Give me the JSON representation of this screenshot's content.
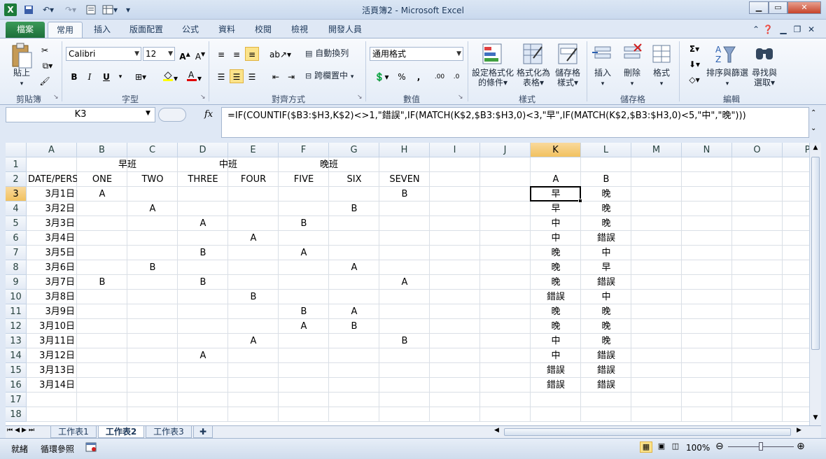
{
  "window": {
    "title": "活頁簿2  -  Microsoft Excel",
    "app_icon": "X"
  },
  "quick_access": [
    "save-icon",
    "undo-icon",
    "redo-icon",
    "print-preview-icon",
    "table-icon",
    "customize-icon"
  ],
  "tabs": [
    "檔案",
    "常用",
    "插入",
    "版面配置",
    "公式",
    "資料",
    "校閱",
    "檢視",
    "開發人員"
  ],
  "ribbon": {
    "clipboard": {
      "paste": "貼上",
      "label": "剪貼簿"
    },
    "font": {
      "name": "Calibri",
      "size": "12",
      "bold": "B",
      "italic": "I",
      "underline": "U",
      "label": "字型"
    },
    "alignment": {
      "wrap": "自動換列",
      "merge": "跨欄置中",
      "label": "對齊方式"
    },
    "number": {
      "format": "通用格式",
      "percent": "%",
      "comma": ",",
      "label": "數值"
    },
    "styles": {
      "conditional": [
        "設定格式化",
        "的條件"
      ],
      "format_table": [
        "格式化為",
        "表格"
      ],
      "cell_styles": [
        "儲存格",
        "樣式"
      ],
      "label": "樣式"
    },
    "cells": {
      "insert": "插入",
      "delete": "刪除",
      "format": "格式",
      "label": "儲存格"
    },
    "editing": {
      "sort": "排序與篩選",
      "find": [
        "尋找與",
        "選取"
      ],
      "label": "編輯"
    }
  },
  "formula_bar": {
    "name_box": "K3",
    "fx": "fx",
    "formula": "=IF(COUNTIF($B3:$H3,K$2)<>1,\"錯誤\",IF(MATCH(K$2,$B3:$H3,0)<3,\"早\",IF(MATCH(K$2,$B3:$H3,0)<5,\"中\",\"晚\")))"
  },
  "grid": {
    "columns": [
      "A",
      "B",
      "C",
      "D",
      "E",
      "F",
      "G",
      "H",
      "I",
      "J",
      "K",
      "L",
      "M",
      "N",
      "O",
      "P"
    ],
    "rows": [
      "1",
      "2",
      "3",
      "4",
      "5",
      "6",
      "7",
      "8",
      "9",
      "10",
      "11",
      "12",
      "13",
      "14",
      "15",
      "16",
      "17",
      "18"
    ],
    "active_cell": "K3",
    "row1": {
      "B": "早班",
      "D": "中班",
      "F": "晚班"
    },
    "row2": {
      "A": "DATE/PERS",
      "B": "ONE",
      "C": "TWO",
      "D": "THREE",
      "E": "FOUR",
      "F": "FIVE",
      "G": "SIX",
      "H": "SEVEN",
      "K": "A",
      "L": "B"
    },
    "data": [
      {
        "A": "3月1日",
        "B": "A",
        "H": "B",
        "K": "早",
        "L": "晚"
      },
      {
        "A": "3月2日",
        "C": "A",
        "G": "B",
        "K": "早",
        "L": "晚"
      },
      {
        "A": "3月3日",
        "D": "A",
        "F": "B",
        "K": "中",
        "L": "晚"
      },
      {
        "A": "3月4日",
        "E": "A",
        "K": "中",
        "L": "錯誤"
      },
      {
        "A": "3月5日",
        "D": "B",
        "F": "A",
        "K": "晚",
        "L": "中"
      },
      {
        "A": "3月6日",
        "C": "B",
        "G": "A",
        "K": "晚",
        "L": "早"
      },
      {
        "A": "3月7日",
        "B": "B",
        "D": "B",
        "H": "A",
        "K": "晚",
        "L": "錯誤"
      },
      {
        "A": "3月8日",
        "E": "B",
        "K": "錯誤",
        "L": "中"
      },
      {
        "A": "3月9日",
        "F": "B",
        "G": "A",
        "K": "晚",
        "L": "晚"
      },
      {
        "A": "3月10日",
        "F": "A",
        "G": "B",
        "K": "晚",
        "L": "晚"
      },
      {
        "A": "3月11日",
        "E": "A",
        "H": "B",
        "K": "中",
        "L": "晚"
      },
      {
        "A": "3月12日",
        "D": "A",
        "K": "中",
        "L": "錯誤"
      },
      {
        "A": "3月13日",
        "K": "錯誤",
        "L": "錯誤"
      },
      {
        "A": "3月14日",
        "K": "錯誤",
        "L": "錯誤"
      }
    ]
  },
  "sheets": [
    "工作表1",
    "工作表2",
    "工作表3"
  ],
  "active_sheet": "工作表2",
  "status": {
    "ready": "就緒",
    "circular": "循環參照",
    "zoom": "100%"
  },
  "colors": {
    "file_tab": "#1e6f3a",
    "selection": "#f1c15f",
    "ribbon": "#e4ecf7"
  }
}
